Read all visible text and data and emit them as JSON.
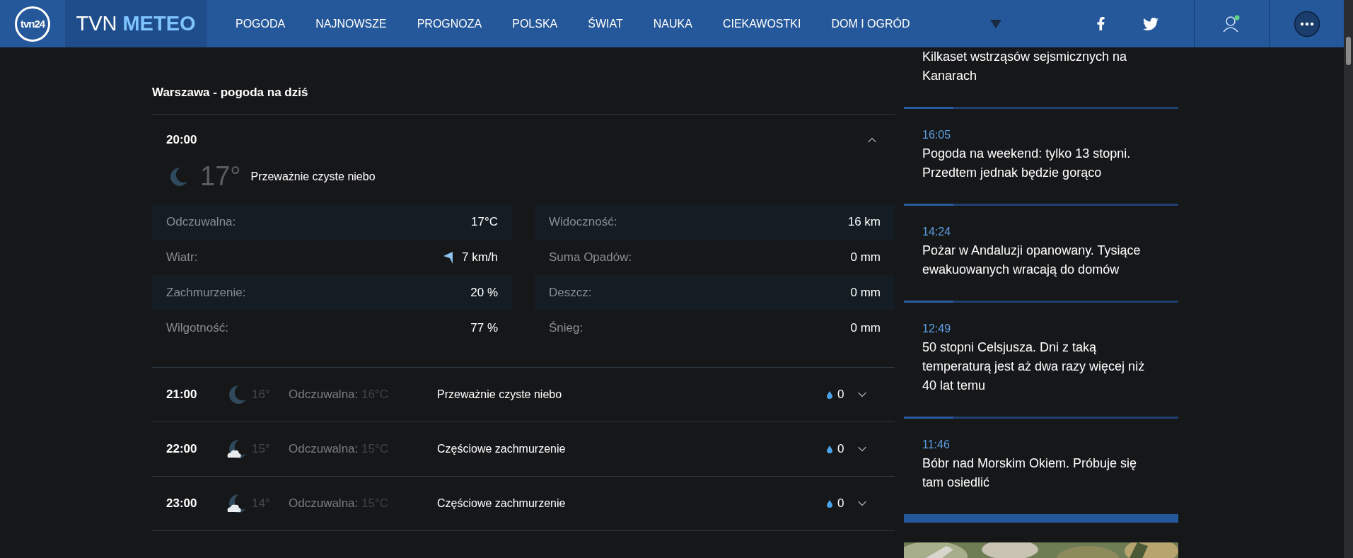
{
  "header": {
    "logo": "tvn24",
    "brand": [
      "TVN",
      "METEO"
    ],
    "nav": [
      "POGODA",
      "NAJNOWSZE",
      "PROGNOZA",
      "POLSKA",
      "ŚWIAT",
      "NAUKA",
      "CIEKAWOSTKI",
      "DOM I OGRÓD"
    ]
  },
  "forecast": {
    "title": "Warszawa - pogoda na dziś",
    "current": {
      "time": "20:00",
      "expanded": true,
      "kind": "moon",
      "temp": "17°",
      "description": "Przeważnie czyste niebo",
      "details": [
        [
          {
            "label": "Odczuwalna:",
            "value": "17°C"
          },
          {
            "label": "Wiatr:",
            "value": "7 km/h",
            "kind": "wind"
          },
          {
            "label": "Zachmurzenie:",
            "value": "20 %"
          },
          {
            "label": "Wilgotność:",
            "value": "77 %"
          }
        ],
        [
          {
            "label": "Widoczność:",
            "value": "16 km"
          },
          {
            "label": "Suma Opadów:",
            "value": "0 mm"
          },
          {
            "label": "Deszcz:",
            "value": "0 mm"
          },
          {
            "label": "Śnieg:",
            "value": "0 mm"
          }
        ]
      ]
    },
    "hours": [
      {
        "time": "21:00",
        "kind": "moon",
        "temp": "16°",
        "feels_label": "Odczuwalna:",
        "feels_value": "16°C",
        "description": "Przeważnie czyste niebo",
        "precip": "0",
        "expanded": false
      },
      {
        "time": "22:00",
        "kind": "moon-cloud",
        "temp": "15°",
        "feels_label": "Odczuwalna:",
        "feels_value": "15°C",
        "description": "Częściowe zachmurzenie",
        "precip": "0",
        "expanded": false
      },
      {
        "time": "23:00",
        "kind": "moon-cloud",
        "temp": "14°",
        "feels_label": "Odczuwalna:",
        "feels_value": "15°C",
        "description": "Częściowe zachmurzenie",
        "precip": "0",
        "expanded": false
      }
    ]
  },
  "news": [
    {
      "title": "Kilkaset wstrząsów sejsmicznych na Kanarach"
    },
    {
      "time": "16:05",
      "title": "Pogoda na weekend: tylko 13 stopni. Przedtem jednak będzie gorąco"
    },
    {
      "time": "14:24",
      "title": "Pożar w Andaluzji opanowany. Tysiące ewakuowanych wracają do domów"
    },
    {
      "time": "12:49",
      "title": "50 stopni Celsjusza. Dni z taką temperaturą jest aż dwa razy więcej niż 40 lat temu"
    },
    {
      "time": "11:46",
      "title": "Bóbr nad Morskim Okiem. Próbuje się tam osiedlić"
    }
  ]
}
